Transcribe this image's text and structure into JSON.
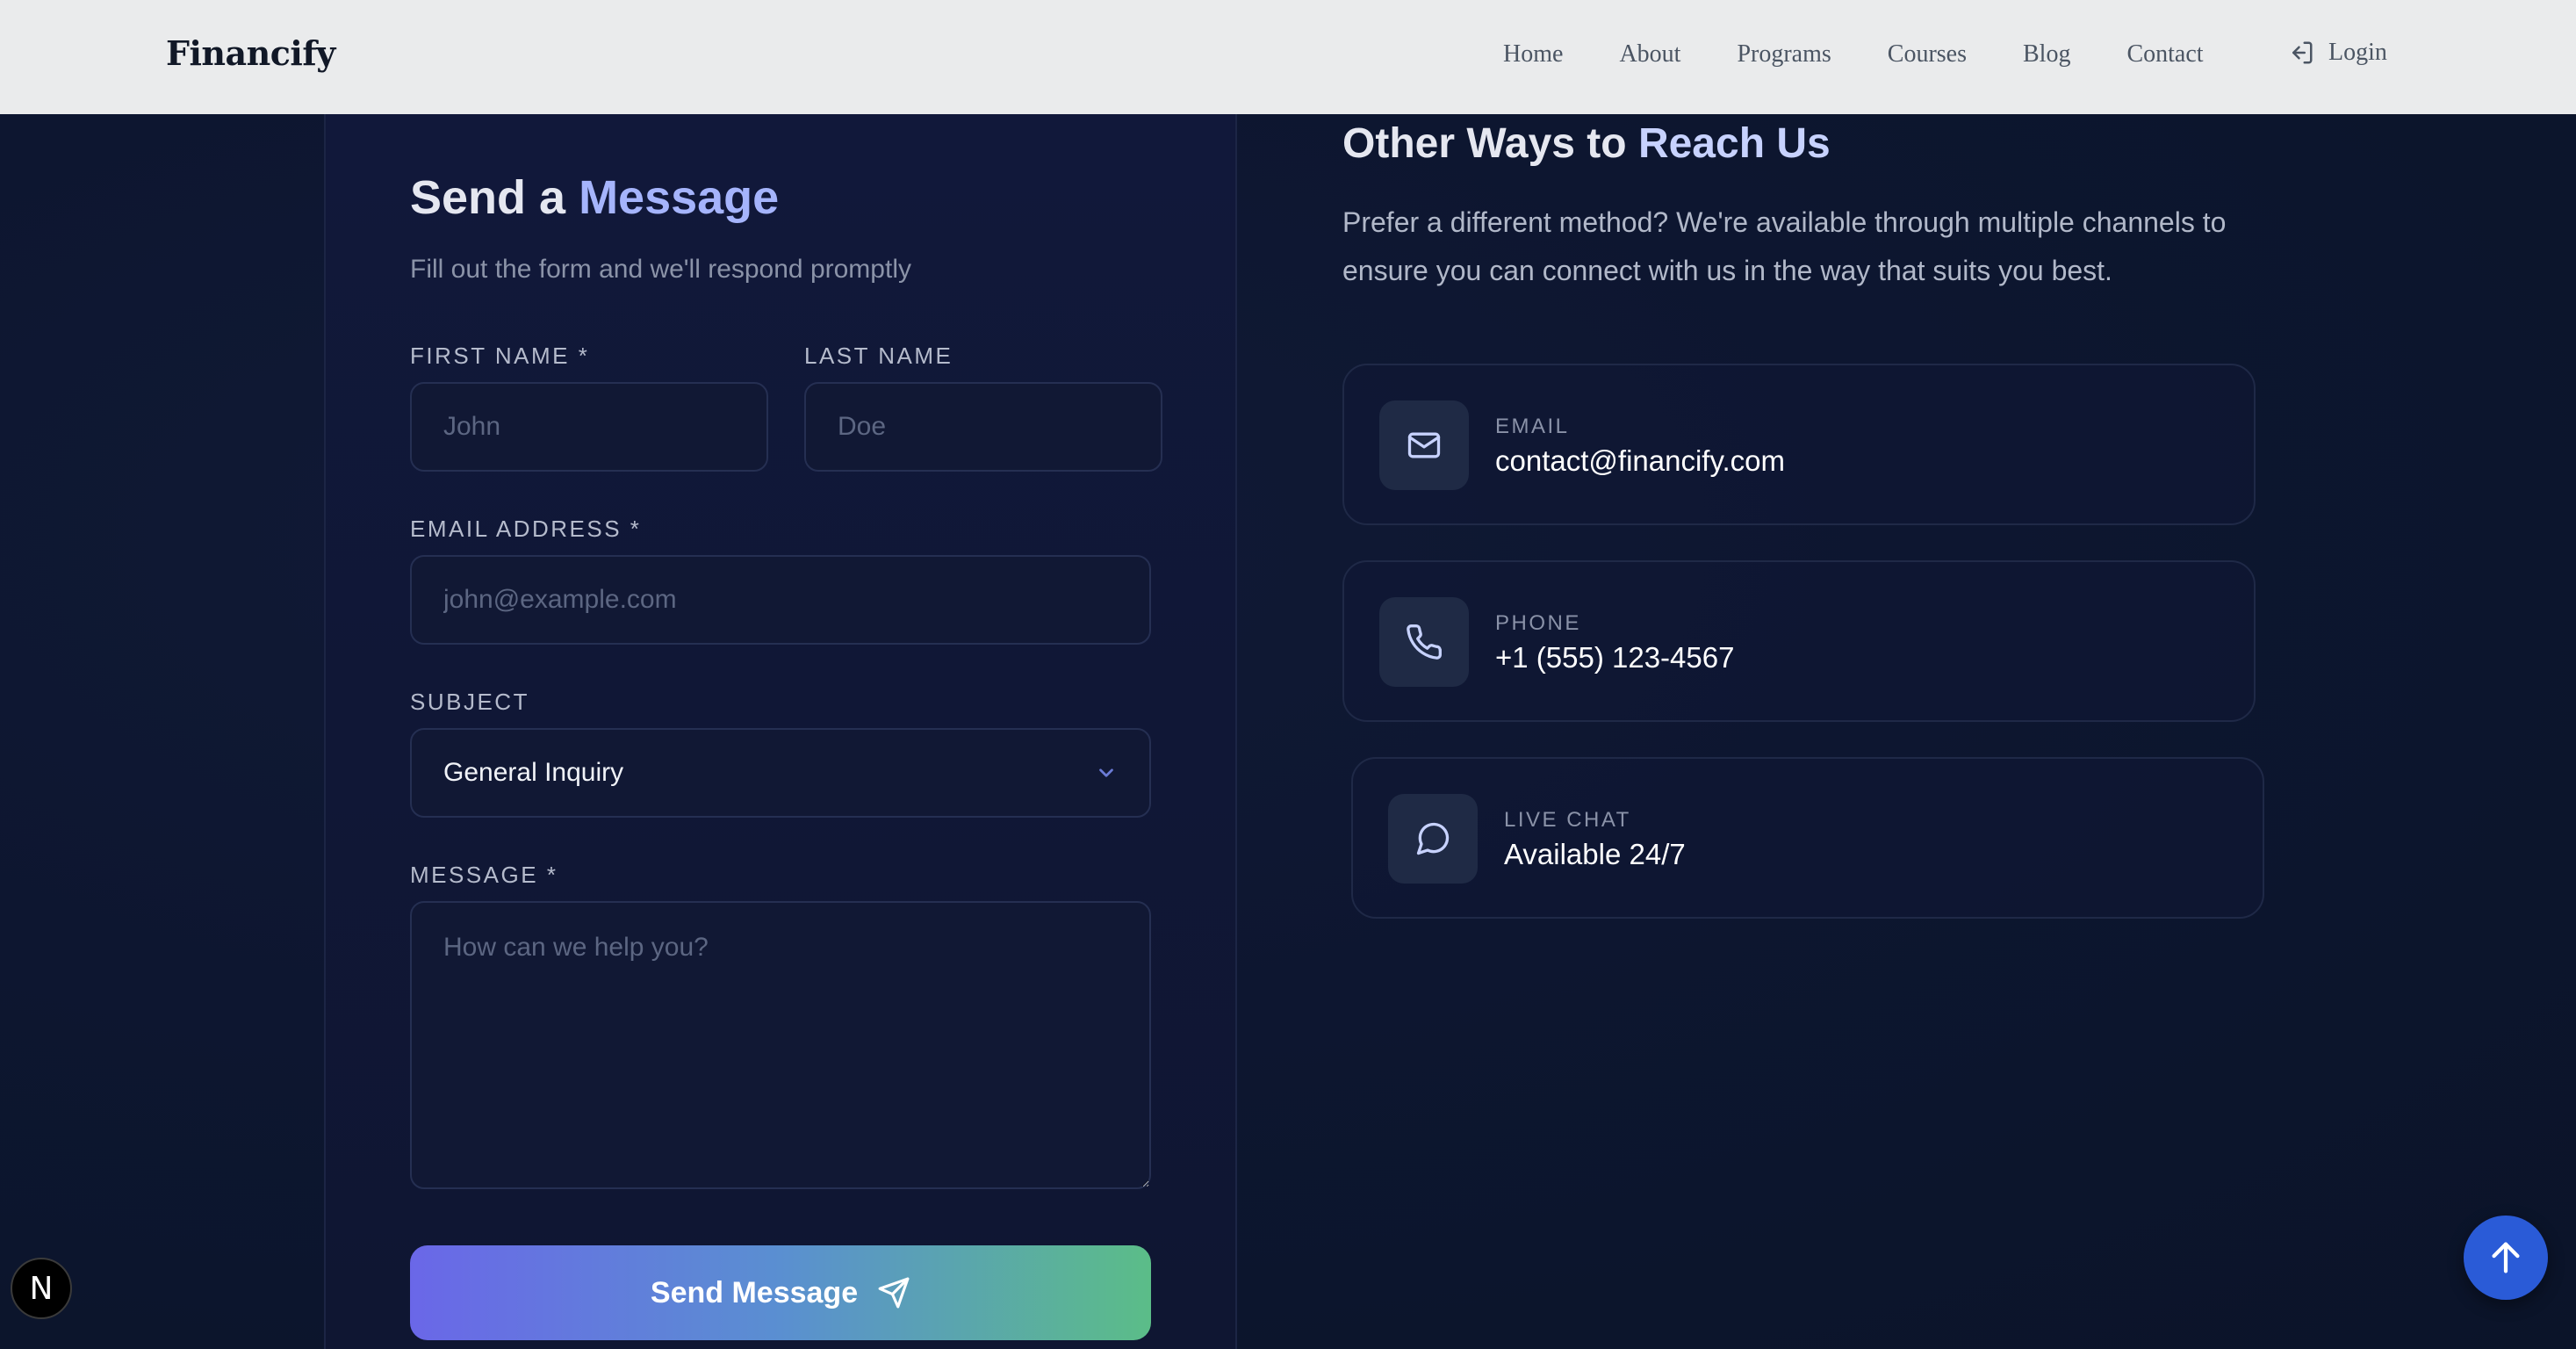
{
  "header": {
    "brand": "Financify",
    "nav": [
      "Home",
      "About",
      "Programs",
      "Courses",
      "Blog",
      "Contact"
    ],
    "login_label": "Login"
  },
  "form": {
    "title_part1": "Send a ",
    "title_accent": "Message",
    "subtitle": "Fill out the form and we'll respond promptly",
    "first_name_label": "FIRST NAME *",
    "first_name_placeholder": "John",
    "last_name_label": "LAST NAME",
    "last_name_placeholder": "Doe",
    "email_label": "EMAIL ADDRESS *",
    "email_placeholder": "john@example.com",
    "subject_label": "SUBJECT",
    "subject_value": "General Inquiry",
    "message_label": "MESSAGE *",
    "message_placeholder": "How can we help you?",
    "submit_label": "Send Message"
  },
  "contact": {
    "title_part1": "Other Ways to ",
    "title_accent": "Reach Us",
    "description": "Prefer a different method? We're available through multiple channels to ensure you can connect with us in the way that suits you best.",
    "cards": [
      {
        "label": "EMAIL",
        "value": "contact@financify.com",
        "icon": "mail-icon"
      },
      {
        "label": "PHONE",
        "value": "+1 (555) 123-4567",
        "icon": "phone-icon"
      },
      {
        "label": "LIVE CHAT",
        "value": "Available 24/7",
        "icon": "chat-icon"
      }
    ]
  },
  "floating": {
    "n_badge": "N"
  },
  "colors": {
    "accent": "#a5b4fc",
    "header_bg": "#eaebec",
    "page_bg": "#0d1630",
    "button_gradient_start": "#6a67e8",
    "button_gradient_end": "#5bbd88",
    "scroll_top_bg": "#2a5bd7"
  }
}
